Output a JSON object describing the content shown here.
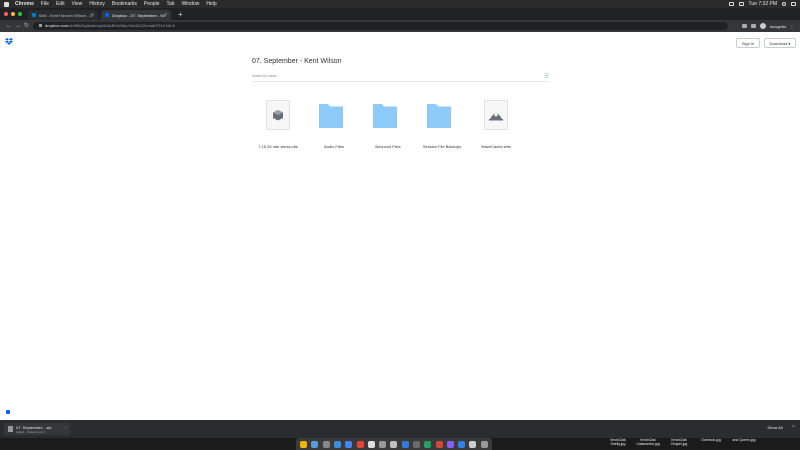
{
  "menubar": {
    "app": "Chrome",
    "items": [
      "File",
      "Edit",
      "View",
      "History",
      "Bookmarks",
      "People",
      "Tab",
      "Window",
      "Help"
    ],
    "clock": "Tue 7:32 PM"
  },
  "tabs": [
    {
      "label": "Mail - Kent Hansen Wilson - O",
      "favicon_color": "#0078d4"
    },
    {
      "label": "Dropbox - 07. September - Ke",
      "favicon_color": "#0061fe"
    }
  ],
  "addressbar": {
    "host": "dropbox.com",
    "path": "/sh/f8fn3q4bsihmq34/AABVsS8oLSmIA2ZZumaKFZ1e?dl=0",
    "incognito_label": "Incognito"
  },
  "page": {
    "signin_label": "Sign in",
    "download_label": "Download ▾",
    "title": "07. September - Kent Wilson",
    "sorted_label": "Sorted by name",
    "items": [
      {
        "name": "7.15.20 ode sierra,ults",
        "kind": "package"
      },
      {
        "name": "Audio Files",
        "kind": "folder"
      },
      {
        "name": "Bounced Files",
        "kind": "folder"
      },
      {
        "name": "Session File Backups",
        "kind": "folder"
      },
      {
        "name": "WaveCache.wfm",
        "kind": "audio-file"
      }
    ]
  },
  "downloads": {
    "filename": "07. September....zip",
    "status": "Failed - Network error",
    "show_all": "Show All"
  },
  "desktop_files": [
    {
      "line1": "Kevin/Zak",
      "line2": "Shelly.jpg"
    },
    {
      "line1": "Kevin/Zak",
      "line2": "Catacombs.jpg"
    },
    {
      "line1": "Kevin/Zak",
      "line2": "Chapel.jpg"
    },
    {
      "line1": "",
      "line2": "Overlook.jpg"
    },
    {
      "line1": "",
      "line2": "and Queen.jpg"
    },
    {
      "line1": "",
      "line2": ""
    }
  ],
  "colors": {
    "folder": "#8ecaf8",
    "dropbox_blue": "#0061fe"
  }
}
